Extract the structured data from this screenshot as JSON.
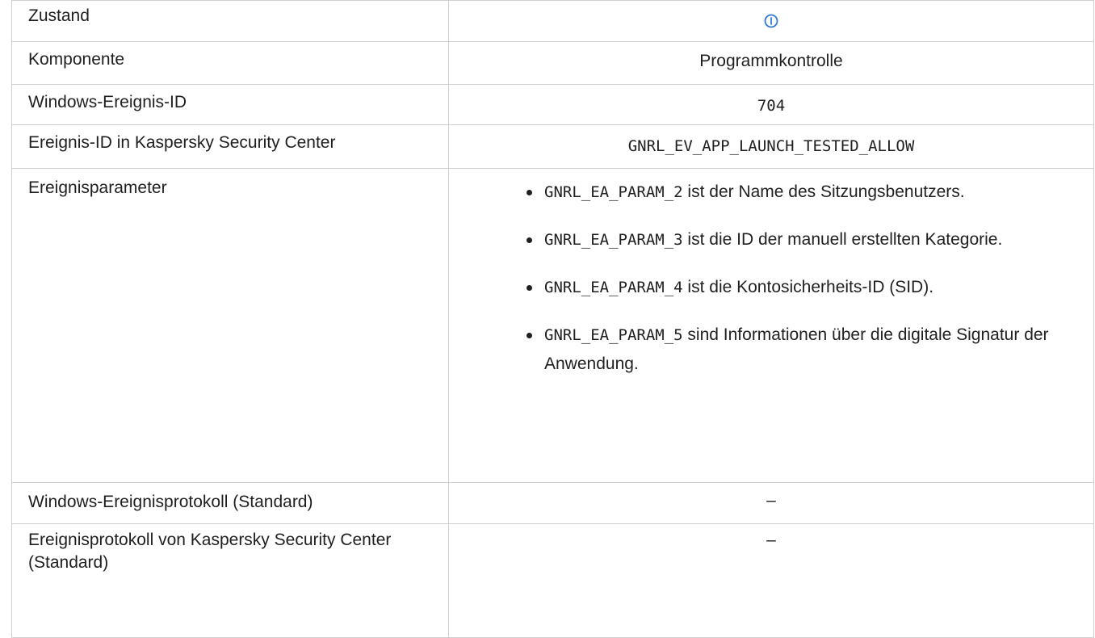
{
  "rows": {
    "status": {
      "label": "Zustand",
      "icon": "info-circle-icon",
      "icon_color": "#2e7bd6"
    },
    "component": {
      "label": "Komponente",
      "value": "Programmkontrolle"
    },
    "windows_event_id": {
      "label": "Windows-Ereignis-ID",
      "value": "704"
    },
    "ksc_event_id": {
      "label": "Ereignis-ID in Kaspersky Security Center",
      "value": "GNRL_EV_APP_LAUNCH_TESTED_ALLOW"
    },
    "event_params": {
      "label": "Ereignisparameter",
      "items": [
        {
          "code": "GNRL_EA_PARAM_2",
          "text": " ist der Name des Sitzungsbenutzers."
        },
        {
          "code": "GNRL_EA_PARAM_3",
          "text": " ist die ID der manuell erstellten Kategorie."
        },
        {
          "code": "GNRL_EA_PARAM_4",
          "text": " ist die Kontosicherheits-ID (SID)."
        },
        {
          "code": "GNRL_EA_PARAM_5",
          "text": " sind Informationen über die digitale Signatur der Anwendung."
        }
      ]
    },
    "windows_log": {
      "label": "Windows-Ereignisprotokoll (Standard)",
      "value": "–"
    },
    "ksc_log": {
      "label": "Ereignisprotokoll von Kaspersky Security Center (Standard)",
      "value": "–"
    }
  }
}
